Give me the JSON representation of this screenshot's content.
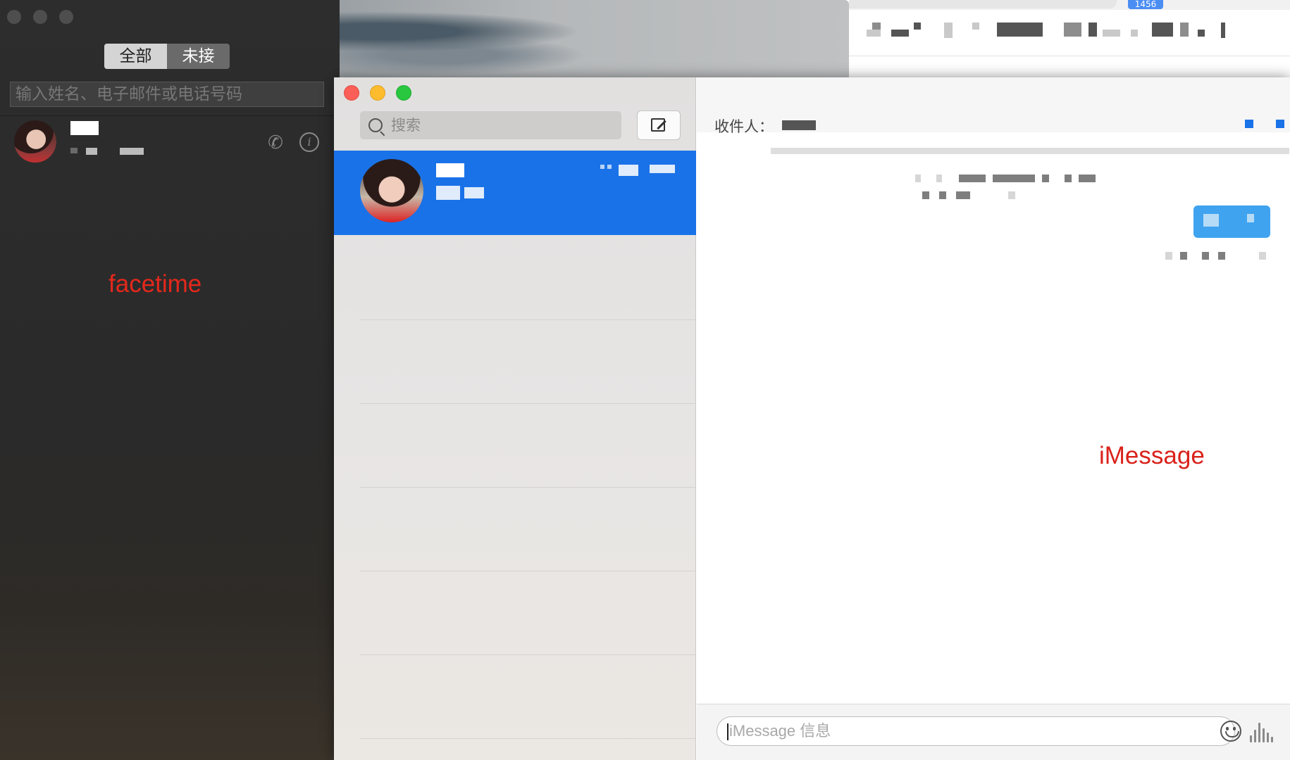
{
  "browser": {
    "badge": "1456"
  },
  "facetime": {
    "tabs": [
      {
        "label": "全部",
        "active": true
      },
      {
        "label": "未接",
        "active": false
      }
    ],
    "search_placeholder": "输入姓名、电子邮件或电话号码",
    "contact": {
      "call_icon": "phone-icon",
      "info_icon": "info-icon",
      "info_glyph": "i"
    },
    "annotation": "facetime"
  },
  "messages": {
    "search_placeholder": "搜索",
    "compose_icon": "compose-icon",
    "to_label": "收件人：",
    "input_placeholder": "iMessage 信息",
    "annotation": "iMessage",
    "colors": {
      "selection": "#1a72e8",
      "bubble": "#3fa3f0",
      "annotation": "#d9221b",
      "close": "#fc5f57",
      "minimize": "#fdbc2e",
      "maximize": "#29c740"
    }
  }
}
